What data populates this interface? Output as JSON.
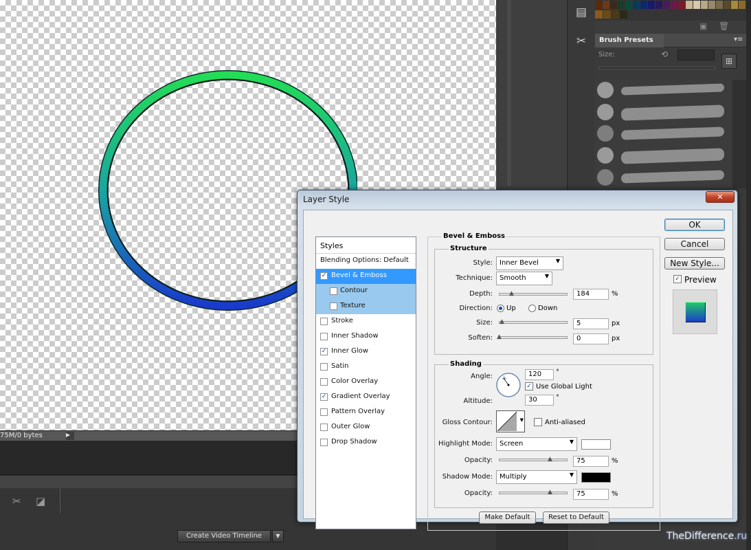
{
  "status_bar": {
    "text": "75M/0 bytes"
  },
  "timeline": {
    "create_button": "Create Video Timeline"
  },
  "brush_presets": {
    "title": "Brush Presets",
    "size_label": "Size:"
  },
  "colors": {
    "dialog_selection": "#3399ff",
    "ring_top": "#22dd55",
    "ring_bottom": "#1a3acc",
    "highlight_color": "#ffffff",
    "shadow_color": "#000000"
  },
  "dialog": {
    "title": "Layer Style",
    "close_glyph": "✕",
    "buttons": {
      "ok": "OK",
      "cancel": "Cancel",
      "new_style": "New Style...",
      "preview": "Preview"
    },
    "styles_header": "Styles",
    "styles": [
      {
        "label": "Blending Options: Default",
        "checkbox": false,
        "checked": false
      },
      {
        "label": "Bevel & Emboss",
        "checkbox": true,
        "checked": true,
        "selected": true
      },
      {
        "label": "Contour",
        "checkbox": true,
        "checked": false,
        "sub": true
      },
      {
        "label": "Texture",
        "checkbox": true,
        "checked": false,
        "sub": true
      },
      {
        "label": "Stroke",
        "checkbox": true,
        "checked": false
      },
      {
        "label": "Inner Shadow",
        "checkbox": true,
        "checked": false
      },
      {
        "label": "Inner Glow",
        "checkbox": true,
        "checked": true
      },
      {
        "label": "Satin",
        "checkbox": true,
        "checked": false
      },
      {
        "label": "Color Overlay",
        "checkbox": true,
        "checked": false
      },
      {
        "label": "Gradient Overlay",
        "checkbox": true,
        "checked": true
      },
      {
        "label": "Pattern Overlay",
        "checkbox": true,
        "checked": false
      },
      {
        "label": "Outer Glow",
        "checkbox": true,
        "checked": false
      },
      {
        "label": "Drop Shadow",
        "checkbox": true,
        "checked": false
      }
    ],
    "bevel": {
      "section_title": "Bevel & Emboss",
      "structure_title": "Structure",
      "style_label": "Style:",
      "style_value": "Inner Bevel",
      "technique_label": "Technique:",
      "technique_value": "Smooth",
      "depth_label": "Depth:",
      "depth_value": "184",
      "depth_unit": "%",
      "direction_label": "Direction:",
      "direction_up": "Up",
      "direction_down": "Down",
      "direction_selected": "Up",
      "size_label": "Size:",
      "size_value": "5",
      "size_unit": "px",
      "soften_label": "Soften:",
      "soften_value": "0",
      "soften_unit": "px",
      "shading_title": "Shading",
      "angle_label": "Angle:",
      "angle_value": "120",
      "angle_unit": "°",
      "use_global_light": "Use Global Light",
      "use_global_light_checked": true,
      "altitude_label": "Altitude:",
      "altitude_value": "30",
      "altitude_unit": "°",
      "gloss_contour_label": "Gloss Contour:",
      "anti_aliased": "Anti-aliased",
      "anti_aliased_checked": false,
      "highlight_mode_label": "Highlight Mode:",
      "highlight_mode_value": "Screen",
      "highlight_opacity_label": "Opacity:",
      "highlight_opacity_value": "75",
      "highlight_opacity_unit": "%",
      "shadow_mode_label": "Shadow Mode:",
      "shadow_mode_value": "Multiply",
      "shadow_opacity_label": "Opacity:",
      "shadow_opacity_value": "75",
      "shadow_opacity_unit": "%",
      "make_default": "Make Default",
      "reset_default": "Reset to Default"
    }
  },
  "watermark": {
    "main": "TheDifference",
    "suffix": ".ru"
  }
}
